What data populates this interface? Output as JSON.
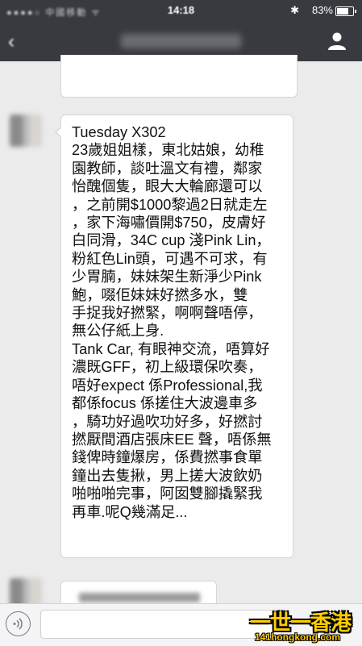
{
  "status_bar": {
    "carrier": "中國移動",
    "time": "14:18",
    "battery_text": "83%",
    "battery_level": 0.83
  },
  "nav": {
    "back_icon": "chevron-left-icon",
    "profile_icon": "person-icon"
  },
  "message": {
    "lines": [
      "Tuesday X302",
      "23歲姐姐樣，東北姑娘，幼稚",
      "園教師，談吐溫文有禮，鄰家",
      "怡醜個隻，眼大大輪廊還可以",
      "，之前開$1000黎過2日就走左",
      "，家下海嘯價開$750，皮膚好",
      "白同滑，34C cup 淺Pink Lin，",
      "粉紅色Lin頭，可遇不可求，有",
      "少胃腩，妹妹架生新淨少Pink",
      "鮑，啜佢妹妹好撚多水，雙",
      "手捉我好撚緊，啊啊聲唔停，",
      "無公仔紙上身.",
      "Tank Car, 有眼神交流，唔算好",
      "濃既GFF，初上級環保吹奏，",
      "唔好expect 係Professional,我",
      "都係focus 係搓住大波邊車多",
      "，騎功好過吹功好多，好撚討",
      "撚厭間酒店張床EE 聲，唔係無",
      "錢俾時鐘爆房，係費撚事食單",
      "鐘出去隻揪，男上搓大波飲奶",
      "啪啪啪完事，阿囡雙腳撬緊我",
      "再車.呢Q幾滿足..."
    ]
  },
  "input_bar": {
    "voice_icon": "voice-icon"
  },
  "watermark": {
    "title": "一世一香港",
    "domain": "141hongkong.com"
  },
  "colors": {
    "nav_bg": "#393a3f",
    "chat_bg": "#ebebeb",
    "bubble_bg": "#ffffff",
    "watermark": "#ffcc00"
  }
}
